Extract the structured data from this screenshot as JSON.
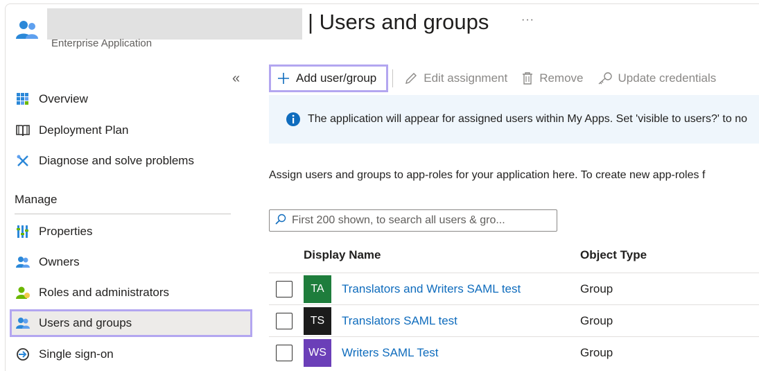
{
  "header": {
    "title": "| Users and groups",
    "subtitle": "Enterprise Application",
    "more": "···"
  },
  "sidebar": {
    "collapse": "«",
    "items_top": [
      {
        "label": "Overview",
        "icon": "grid-icon"
      },
      {
        "label": "Deployment Plan",
        "icon": "book-icon"
      },
      {
        "label": "Diagnose and solve problems",
        "icon": "wrench-icon"
      }
    ],
    "section": "Manage",
    "items_manage": [
      {
        "label": "Properties",
        "icon": "properties-icon"
      },
      {
        "label": "Owners",
        "icon": "owners-icon"
      },
      {
        "label": "Roles and administrators",
        "icon": "roles-icon"
      },
      {
        "label": "Users and groups",
        "icon": "users-icon",
        "selected": true
      },
      {
        "label": "Single sign-on",
        "icon": "sign-in-icon"
      }
    ]
  },
  "toolbar": {
    "add": "Add user/group",
    "edit": "Edit assignment",
    "remove": "Remove",
    "update": "Update credentials"
  },
  "info": {
    "text": "The application will appear for assigned users within My Apps. Set 'visible to users?' to no"
  },
  "description": "Assign users and groups to app-roles for your application here. To create new app-roles f",
  "search": {
    "placeholder": "First 200 shown, to search all users & gro..."
  },
  "table": {
    "headers": {
      "name": "Display Name",
      "type": "Object Type"
    },
    "rows": [
      {
        "initials": "TA",
        "name": "Translators and Writers SAML test",
        "type": "Group",
        "color": "#1e7d3c"
      },
      {
        "initials": "TS",
        "name": "Translators SAML test",
        "type": "Group",
        "color": "#1b1b1b"
      },
      {
        "initials": "WS",
        "name": "Writers SAML Test",
        "type": "Group",
        "color": "#6b3fb8"
      }
    ]
  },
  "colors": {
    "accent": "#0f6cbd",
    "highlight": "#b3a6f0",
    "info_bg": "#eff6fc"
  }
}
